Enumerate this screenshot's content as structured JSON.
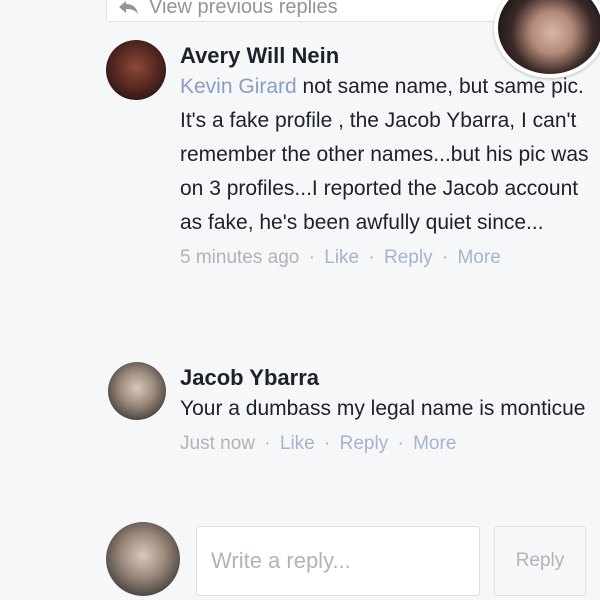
{
  "thread": {
    "view_previous_label": "View previous replies",
    "view_previous_icon": "reply-arrow-icon"
  },
  "chat_head": {
    "icon": "chat-head-avatar"
  },
  "comments": [
    {
      "author": "Avery Will Nein",
      "mention": "Kevin Girard",
      "text": " not same name, but same pic. It's a fake profile , the Jacob Ybarra, I can't remember the other names...but his pic was on 3 profiles...I reported the Jacob account as fake, he's been awfully quiet since...",
      "time": "5 minutes ago",
      "sep": "·",
      "like_label": "Like",
      "reply_label": "Reply",
      "more_label": "More"
    },
    {
      "author": "Jacob Ybarra",
      "text": "Your a dumbass my legal name is monticue",
      "time": "Just now",
      "sep": "·",
      "like_label": "Like",
      "reply_label": "Reply",
      "more_label": "More"
    }
  ],
  "composer": {
    "placeholder": "Write a reply...",
    "value": "",
    "submit_label": "Reply"
  },
  "colors": {
    "background": "#f6f7f9",
    "mention": "#8b9dc3",
    "meta": "#b0b3b8"
  }
}
